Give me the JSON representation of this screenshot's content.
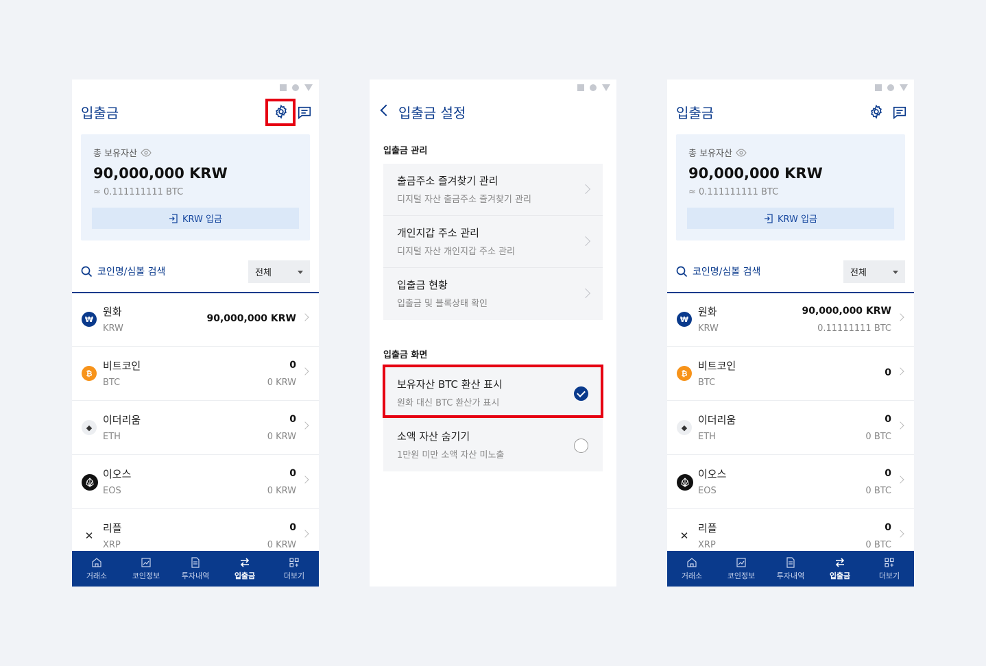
{
  "main": {
    "title": "입출금",
    "asset_label": "총 보유자산",
    "total": "90,000,000 KRW",
    "total_btc": "≈ 0.111111111 BTC",
    "krw_deposit": "KRW 입금",
    "search_placeholder": "코인명/심볼 검색",
    "filter": "전체"
  },
  "coins_krw": [
    {
      "name": "원화",
      "symbol": "KRW",
      "main": "90,000,000 KRW",
      "sub": ""
    },
    {
      "name": "비트코인",
      "symbol": "BTC",
      "main": "0",
      "sub": "0 KRW"
    },
    {
      "name": "이더리움",
      "symbol": "ETH",
      "main": "0",
      "sub": "0 KRW"
    },
    {
      "name": "이오스",
      "symbol": "EOS",
      "main": "0",
      "sub": "0 KRW"
    },
    {
      "name": "리플",
      "symbol": "XRP",
      "main": "0",
      "sub": "0 KRW"
    }
  ],
  "coins_btc": [
    {
      "name": "원화",
      "symbol": "KRW",
      "main": "90,000,000 KRW",
      "sub": "0.11111111 BTC"
    },
    {
      "name": "비트코인",
      "symbol": "BTC",
      "main": "0",
      "sub": ""
    },
    {
      "name": "이더리움",
      "symbol": "ETH",
      "main": "0",
      "sub": "0 BTC"
    },
    {
      "name": "이오스",
      "symbol": "EOS",
      "main": "0",
      "sub": "0 BTC"
    },
    {
      "name": "리플",
      "symbol": "XRP",
      "main": "0",
      "sub": "0 BTC"
    }
  ],
  "tabs": [
    {
      "label": "거래소",
      "icon": "home-icon"
    },
    {
      "label": "코인정보",
      "icon": "chart-icon"
    },
    {
      "label": "투자내역",
      "icon": "document-icon"
    },
    {
      "label": "입출금",
      "icon": "transfer-icon"
    },
    {
      "label": "더보기",
      "icon": "grid-plus-icon"
    }
  ],
  "settings": {
    "title": "입출금 설정",
    "section1": "입출금 관리",
    "items1": [
      {
        "label": "출금주소 즐겨찾기 관리",
        "desc": "디지털 자산 출금주소 즐겨찾기 관리"
      },
      {
        "label": "개인지갑 주소 관리",
        "desc": "디지털 자산 개인지갑 주소 관리"
      },
      {
        "label": "입출금 현황",
        "desc": "입출금 및 블록상태 확인"
      }
    ],
    "section2": "입출금 화면",
    "items2": [
      {
        "label": "보유자산 BTC 환산 표시",
        "desc": "원화 대신 BTC 환산가 표시",
        "checked": true
      },
      {
        "label": "소액 자산 숨기기",
        "desc": "1만원 미만 소액 자산 미노출",
        "checked": false
      }
    ]
  },
  "colors": {
    "primary": "#0a3a8c",
    "highlight": "#e60012",
    "krw_icon": "#0a3a8c",
    "btc_icon": "#f7931a"
  }
}
